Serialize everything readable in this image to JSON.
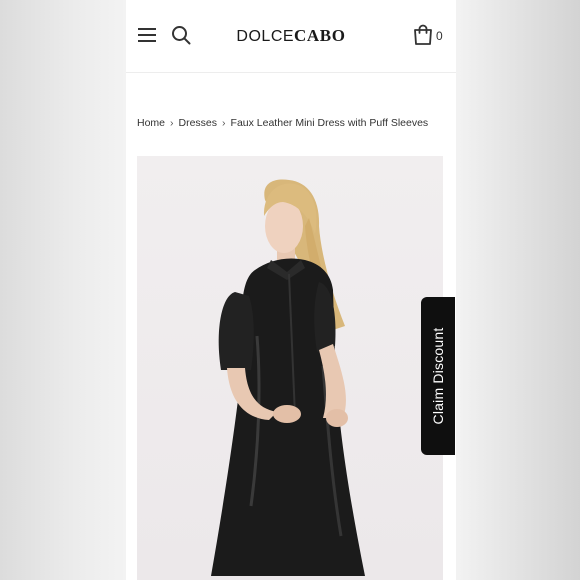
{
  "header": {
    "logo_light": "DOLCE",
    "logo_bold": "CABO",
    "cart_count": "0",
    "icons": [
      "menu-icon",
      "search-icon",
      "cart-icon"
    ]
  },
  "breadcrumb": {
    "items": [
      "Home",
      "Dresses",
      "Faux Leather Mini Dress with Puff Sleeves"
    ],
    "separator": "›"
  },
  "claim_discount": {
    "label": "Claim Discount"
  },
  "colors": {
    "tab_background": "#0f0f0f",
    "dress": "#1b1b1b",
    "image_background": "#efebed"
  }
}
